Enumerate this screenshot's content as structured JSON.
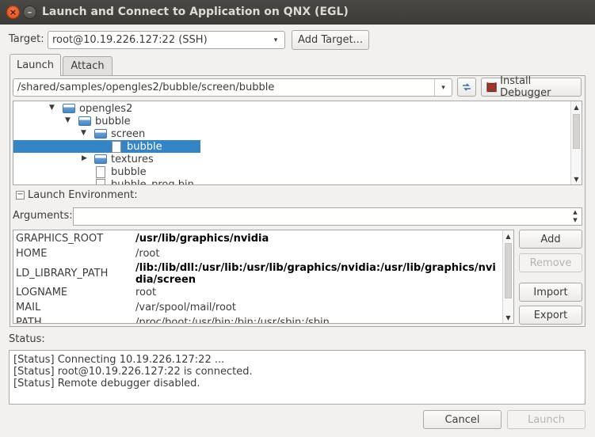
{
  "window": {
    "title": "Launch and Connect to Application on QNX (EGL)",
    "close_glyph": "×",
    "minimize_glyph": "–"
  },
  "target": {
    "label": "Target:",
    "selected": "root@10.19.226.127:22 (SSH)",
    "add_button": "Add Target..."
  },
  "tabs": [
    {
      "label": "Launch",
      "active": true
    },
    {
      "label": "Attach",
      "active": false
    }
  ],
  "launch": {
    "path": "/shared/samples/opengles2/bubble/screen/bubble",
    "install_debugger": "Install Debugger"
  },
  "tree": [
    {
      "label": "opengles2",
      "type": "folder",
      "expanded": true
    },
    {
      "label": "bubble",
      "type": "folder",
      "expanded": true
    },
    {
      "label": "screen",
      "type": "folder",
      "expanded": true
    },
    {
      "label": "bubble",
      "type": "file",
      "selected": true
    },
    {
      "label": "textures",
      "type": "folder",
      "expanded": false
    },
    {
      "label": "bubble",
      "type": "file"
    },
    {
      "label": "bubble_prog.bin",
      "type": "file"
    }
  ],
  "env_section": {
    "toggle_glyph": "−",
    "label": "Launch Environment:"
  },
  "arguments": {
    "label": "Arguments:",
    "value": ""
  },
  "env_vars": [
    {
      "name": "GRAPHICS_ROOT",
      "value": "/usr/lib/graphics/nvidia",
      "bold": true
    },
    {
      "name": "HOME",
      "value": "/root",
      "bold": false
    },
    {
      "name": "LD_LIBRARY_PATH",
      "value": "/lib:/lib/dll:/usr/lib:/usr/lib/graphics/nvidia:/usr/lib/graphics/nvidia/screen",
      "bold": true
    },
    {
      "name": "LOGNAME",
      "value": "root",
      "bold": false
    },
    {
      "name": "MAIL",
      "value": "/var/spool/mail/root",
      "bold": false
    },
    {
      "name": "PATH",
      "value": "/proc/boot:/usr/bin:/bin:/usr/sbin:/sbin",
      "bold": false
    }
  ],
  "env_buttons": {
    "add": "Add",
    "remove": "Remove",
    "import": "Import",
    "export": "Export"
  },
  "status": {
    "label": "Status:",
    "lines": [
      "[Status] Connecting 10.19.226.127:22 ...",
      "[Status] root@10.19.226.127:22 is connected.",
      "[Status] Remote debugger disabled."
    ]
  },
  "footer": {
    "cancel": "Cancel",
    "launch": "Launch"
  },
  "icons": {
    "dropdown": "▾",
    "expanded": "▼",
    "collapsed": "▶",
    "scroll_up": "▲",
    "scroll_down": "▼"
  }
}
